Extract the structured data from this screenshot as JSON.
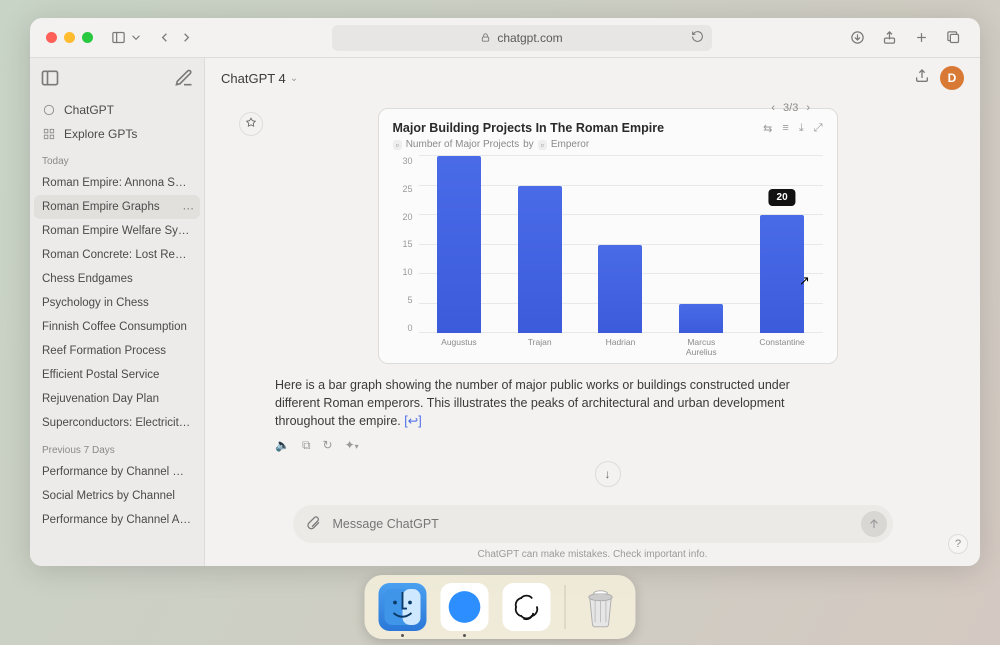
{
  "browser": {
    "url_host": "chatgpt.com"
  },
  "sidebar": {
    "nav": [
      {
        "label": "ChatGPT"
      },
      {
        "label": "Explore GPTs"
      }
    ],
    "section_today": "Today",
    "today": [
      "Roman Empire: Annona Social W…",
      "Roman Empire Graphs",
      "Roman Empire Welfare System",
      "Roman Concrete: Lost Recipe",
      "Chess Endgames",
      "Psychology in Chess",
      "Finnish Coffee Consumption",
      "Reef Formation Process",
      "Efficient Postal Service",
      "Rejuvenation Day Plan",
      "Superconductors: Electricity Rol…"
    ],
    "section_prev": "Previous 7 Days",
    "prev7": [
      "Performance by Channel Chart",
      "Social Metrics by Channel",
      "Performance by Channel Analysi…"
    ]
  },
  "header": {
    "model": "ChatGPT 4",
    "avatar_initial": "D",
    "pager": "3/3"
  },
  "chart_card": {
    "title": "Major Building Projects In The Roman Empire",
    "subhead_metric": "Number of Major Projects",
    "subhead_by": "by",
    "subhead_group": "Emperor",
    "tooltip_value": "20"
  },
  "chart_data": {
    "type": "bar",
    "title": "Major Building Projects In The Roman Empire",
    "xlabel": "Emperor",
    "ylabel": "Number of Major Projects",
    "ylim": [
      0,
      30
    ],
    "yticks": [
      0,
      5,
      10,
      15,
      20,
      25,
      30
    ],
    "categories": [
      "Augustus",
      "Trajan",
      "Hadrian",
      "Marcus Aurelius",
      "Constantine"
    ],
    "values": [
      30,
      25,
      15,
      5,
      20
    ]
  },
  "message": {
    "paragraph": "Here is a bar graph showing the number of major public works or buildings constructed under different Roman emperors. This illustrates the peaks of architectural and urban development throughout the empire.",
    "link": "[↩︎]"
  },
  "composer": {
    "placeholder": "Message ChatGPT"
  },
  "footer": {
    "disclaimer": "ChatGPT can make mistakes. Check important info."
  }
}
